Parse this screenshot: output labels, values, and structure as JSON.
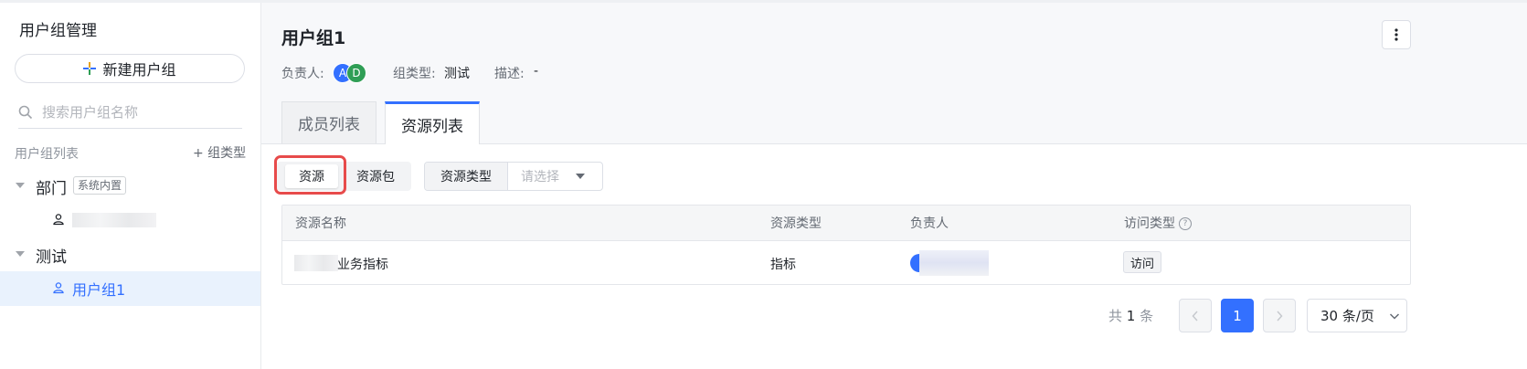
{
  "sidebar": {
    "title": "用户组管理",
    "new_group_label": "新建用户组",
    "search_placeholder": "搜索用户组名称",
    "list_header": "用户组列表",
    "add_group_type_label": "+ 组类型",
    "groups": [
      {
        "name": "部门",
        "tag": "系统内置",
        "children": [
          {
            "name": ""
          }
        ]
      },
      {
        "name": "测试",
        "children": [
          {
            "name": "用户组1",
            "selected": true
          }
        ]
      }
    ]
  },
  "header": {
    "title": "用户组1",
    "owner_label": "负责人:",
    "owner_avatars": [
      {
        "initial": "A",
        "color": "#3370ff"
      },
      {
        "initial": "D",
        "color": "#2f9e55"
      }
    ],
    "group_type_label": "组类型:",
    "group_type_value": "测试",
    "desc_label": "描述:",
    "desc_value": "-",
    "more_icon": "more-vertical-icon"
  },
  "tabs": [
    {
      "label": "成员列表",
      "active": false
    },
    {
      "label": "资源列表",
      "active": true
    }
  ],
  "filters": {
    "segment": [
      {
        "label": "资源",
        "active": true
      },
      {
        "label": "资源包",
        "active": false
      }
    ],
    "resource_type_label": "资源类型",
    "resource_type_placeholder": "请选择"
  },
  "table": {
    "columns": [
      "资源名称",
      "资源类型",
      "负责人",
      "访问类型"
    ],
    "rows": [
      {
        "name": "业务指标",
        "type": "指标",
        "owner": "",
        "access": "访问"
      }
    ]
  },
  "pagination": {
    "total_prefix": "共",
    "total_count": "1",
    "total_suffix": "条",
    "current_page": "1",
    "page_size": "30 条/页"
  },
  "colors": {
    "accent": "#3370ff",
    "highlight": "#e74b4b",
    "selected_bg": "#e9f2fd"
  }
}
